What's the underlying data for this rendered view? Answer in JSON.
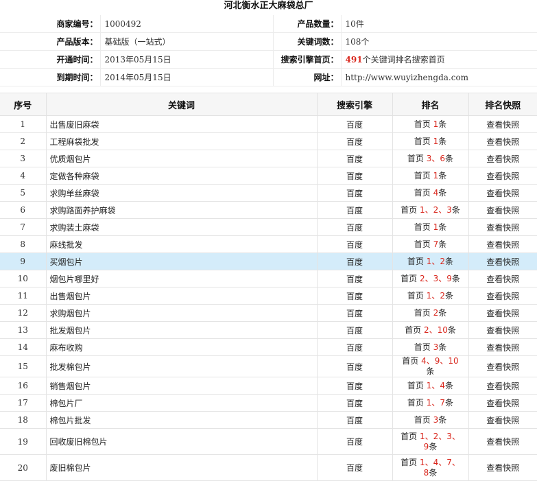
{
  "page_title": "河北衡水正大麻袋总厂",
  "info": {
    "merchant_id_label": "商家编号：",
    "merchant_id": "1000492",
    "product_count_label": "产品数量：",
    "product_count": "10件",
    "version_label": "产品版本：",
    "version": "基础版（一站式）",
    "keyword_count_label": "关键词数：",
    "keyword_count": "108个",
    "open_time_label": "开通时间：",
    "open_time": "2013年05月15日",
    "search_home_label": "搜索引擎首页：",
    "search_home_count": "491",
    "search_home_text": "个关键词排名搜索首页",
    "expire_time_label": "到期时间：",
    "expire_time": "2014年05月15日",
    "website_label": "网址：",
    "website": "http://www.wuyizhengda.com"
  },
  "table": {
    "headers": {
      "seq": "序号",
      "keyword": "关键词",
      "engine": "搜索引擎",
      "rank": "排名",
      "snapshot": "排名快照"
    },
    "rows": [
      {
        "seq": "1",
        "keyword": "出售废旧麻袋",
        "engine": "百度",
        "prefix": "首页",
        "ranks": "1",
        "suffix": "条",
        "snapshot": "查看快照"
      },
      {
        "seq": "2",
        "keyword": "工程麻袋批发",
        "engine": "百度",
        "prefix": "首页",
        "ranks": "1",
        "suffix": "条",
        "snapshot": "查看快照"
      },
      {
        "seq": "3",
        "keyword": "优质烟包片",
        "engine": "百度",
        "prefix": "首页",
        "ranks": "3、6",
        "suffix": "条",
        "snapshot": "查看快照"
      },
      {
        "seq": "4",
        "keyword": "定做各种麻袋",
        "engine": "百度",
        "prefix": "首页",
        "ranks": "1",
        "suffix": "条",
        "snapshot": "查看快照"
      },
      {
        "seq": "5",
        "keyword": "求购单丝麻袋",
        "engine": "百度",
        "prefix": "首页",
        "ranks": "4",
        "suffix": "条",
        "snapshot": "查看快照"
      },
      {
        "seq": "6",
        "keyword": "求购路面养护麻袋",
        "engine": "百度",
        "prefix": "首页",
        "ranks": "1、2、3",
        "suffix": "条",
        "snapshot": "查看快照"
      },
      {
        "seq": "7",
        "keyword": "求购装土麻袋",
        "engine": "百度",
        "prefix": "首页",
        "ranks": "1",
        "suffix": "条",
        "snapshot": "查看快照"
      },
      {
        "seq": "8",
        "keyword": "麻线批发",
        "engine": "百度",
        "prefix": "首页",
        "ranks": "7",
        "suffix": "条",
        "snapshot": "查看快照"
      },
      {
        "seq": "9",
        "keyword": "买烟包片",
        "engine": "百度",
        "prefix": "首页",
        "ranks": "1、2",
        "suffix": "条",
        "snapshot": "查看快照"
      },
      {
        "seq": "10",
        "keyword": "烟包片哪里好",
        "engine": "百度",
        "prefix": "首页",
        "ranks": "2、3、9",
        "suffix": "条",
        "snapshot": "查看快照"
      },
      {
        "seq": "11",
        "keyword": "出售烟包片",
        "engine": "百度",
        "prefix": "首页",
        "ranks": "1、2",
        "suffix": "条",
        "snapshot": "查看快照"
      },
      {
        "seq": "12",
        "keyword": "求购烟包片",
        "engine": "百度",
        "prefix": "首页",
        "ranks": "2",
        "suffix": "条",
        "snapshot": "查看快照"
      },
      {
        "seq": "13",
        "keyword": "批发烟包片",
        "engine": "百度",
        "prefix": "首页",
        "ranks": "2、10",
        "suffix": "条",
        "snapshot": "查看快照"
      },
      {
        "seq": "14",
        "keyword": "麻布收购",
        "engine": "百度",
        "prefix": "首页",
        "ranks": "3",
        "suffix": "条",
        "snapshot": "查看快照"
      },
      {
        "seq": "15",
        "keyword": "批发棉包片",
        "engine": "百度",
        "prefix": "首页",
        "ranks": "4、9、10",
        "suffix": "条",
        "snapshot": "查看快照"
      },
      {
        "seq": "16",
        "keyword": "销售烟包片",
        "engine": "百度",
        "prefix": "首页",
        "ranks": "1、4",
        "suffix": "条",
        "snapshot": "查看快照"
      },
      {
        "seq": "17",
        "keyword": "棉包片厂",
        "engine": "百度",
        "prefix": "首页",
        "ranks": "1、7",
        "suffix": "条",
        "snapshot": "查看快照"
      },
      {
        "seq": "18",
        "keyword": "棉包片批发",
        "engine": "百度",
        "prefix": "首页",
        "ranks": "3",
        "suffix": "条",
        "snapshot": "查看快照"
      },
      {
        "seq": "19",
        "keyword": "回收废旧棉包片",
        "engine": "百度",
        "prefix": "首页",
        "ranks": "1、2、3、9",
        "suffix": "条",
        "snapshot": "查看快照"
      },
      {
        "seq": "20",
        "keyword": "废旧棉包片",
        "engine": "百度",
        "prefix": "首页",
        "ranks": "1、4、7、8",
        "suffix": "条",
        "snapshot": "查看快照"
      }
    ],
    "highlighted_row": "9"
  },
  "colors": {
    "rank_red": "#d9261c",
    "highlight_row": "#d4ecfa",
    "header_bg": "#f6f6f6"
  }
}
